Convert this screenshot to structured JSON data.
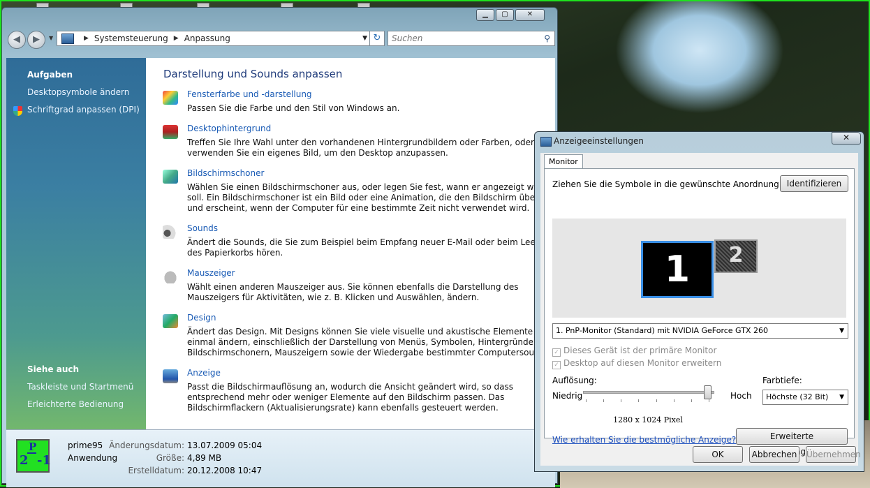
{
  "control_panel": {
    "address": {
      "root": "Systemsteuerung",
      "current": "Anpassung"
    },
    "search_placeholder": "Suchen",
    "sidebar": {
      "tasks_heading": "Aufgaben",
      "tasks": [
        "Desktopsymbole ändern",
        "Schriftgrad anpassen (DPI)"
      ],
      "see_also_heading": "Siehe auch",
      "see_also": [
        "Taskleiste und Startmenü",
        "Erleichterte Bedienung"
      ]
    },
    "heading": "Darstellung und Sounds anpassen",
    "items": [
      {
        "title": "Fensterfarbe und -darstellung",
        "desc": "Passen Sie die Farbe und den Stil von Windows an.",
        "icon": "window-color-icon"
      },
      {
        "title": "Desktophintergrund",
        "desc": "Treffen Sie Ihre Wahl unter den vorhandenen Hintergrundbildern oder Farben, oder verwenden Sie ein eigenes Bild, um den Desktop anzupassen.",
        "icon": "desktop-background-icon"
      },
      {
        "title": "Bildschirmschoner",
        "desc": "Wählen Sie einen Bildschirmschoner aus, oder legen Sie fest, wann er angezeigt werden soll. Ein Bildschirmschoner ist ein Bild oder eine Animation, die den Bildschirm überdeckt und erscheint, wenn der Computer für eine bestimmte Zeit nicht verwendet wird.",
        "icon": "screensaver-icon"
      },
      {
        "title": "Sounds",
        "desc": "Ändert die Sounds, die Sie zum Beispiel beim Empfang neuer E-Mail oder beim Leeren des Papierkorbs hören.",
        "icon": "sounds-icon"
      },
      {
        "title": "Mauszeiger",
        "desc": "Wählt einen anderen Mauszeiger aus. Sie können ebenfalls die Darstellung des Mauszeigers für Aktivitäten, wie z. B. Klicken und Auswählen, ändern.",
        "icon": "mouse-pointer-icon"
      },
      {
        "title": "Design",
        "desc": "Ändert das Design. Mit Designs können Sie viele visuelle und akustische Elemente auf einmal ändern, einschließlich der Darstellung von Menüs, Symbolen, Hintergründen, Bildschirmschonern, Mauszeigern sowie der Wiedergabe bestimmter Computersounds.",
        "icon": "theme-icon"
      },
      {
        "title": "Anzeige",
        "desc": "Passt die Bildschirmauflösung an, wodurch die Ansicht geändert wird, so dass entsprechend mehr oder weniger Elemente auf den Bildschirm passen. Das Bildschirmflackern (Aktualisierungsrate) kann ebenfalls gesteuert werden.",
        "icon": "display-icon"
      }
    ],
    "details": {
      "name": "prime95",
      "type": "Anwendung",
      "modified_label": "Änderungsdatum:",
      "modified": "13.07.2009 05:04",
      "size_label": "Größe:",
      "size": "4,89 MB",
      "created_label": "Erstelldatum:",
      "created": "20.12.2008 10:47",
      "icon_text": {
        "left": "2",
        "top": "P",
        "right": "-1"
      }
    }
  },
  "display_dialog": {
    "title": "Anzeigeeinstellungen",
    "tab": "Monitor",
    "instruction": "Ziehen Sie die Symbole in die gewünschte Anordnung.",
    "identify": "Identifizieren",
    "monitors": [
      "1",
      "2"
    ],
    "monitor_select": "1. PnP-Monitor (Standard) mit NVIDIA GeForce GTX 260",
    "primary_check": "Dieses Gerät ist der primäre Monitor",
    "extend_check": "Desktop auf diesen Monitor erweitern",
    "resolution_label": "Auflösung:",
    "low": "Niedrig",
    "high": "Hoch",
    "resolution_value": "1280 x 1024 Pixel",
    "slider_fraction": 0.98,
    "color_depth_label": "Farbtiefe:",
    "color_depth": "Höchste (32 Bit)",
    "help_link": "Wie erhalten Sie die bestmögliche Anzeige?",
    "advanced": "Erweiterte Einstellungen...",
    "ok": "OK",
    "cancel": "Abbrechen",
    "apply": "Übernehmen"
  }
}
